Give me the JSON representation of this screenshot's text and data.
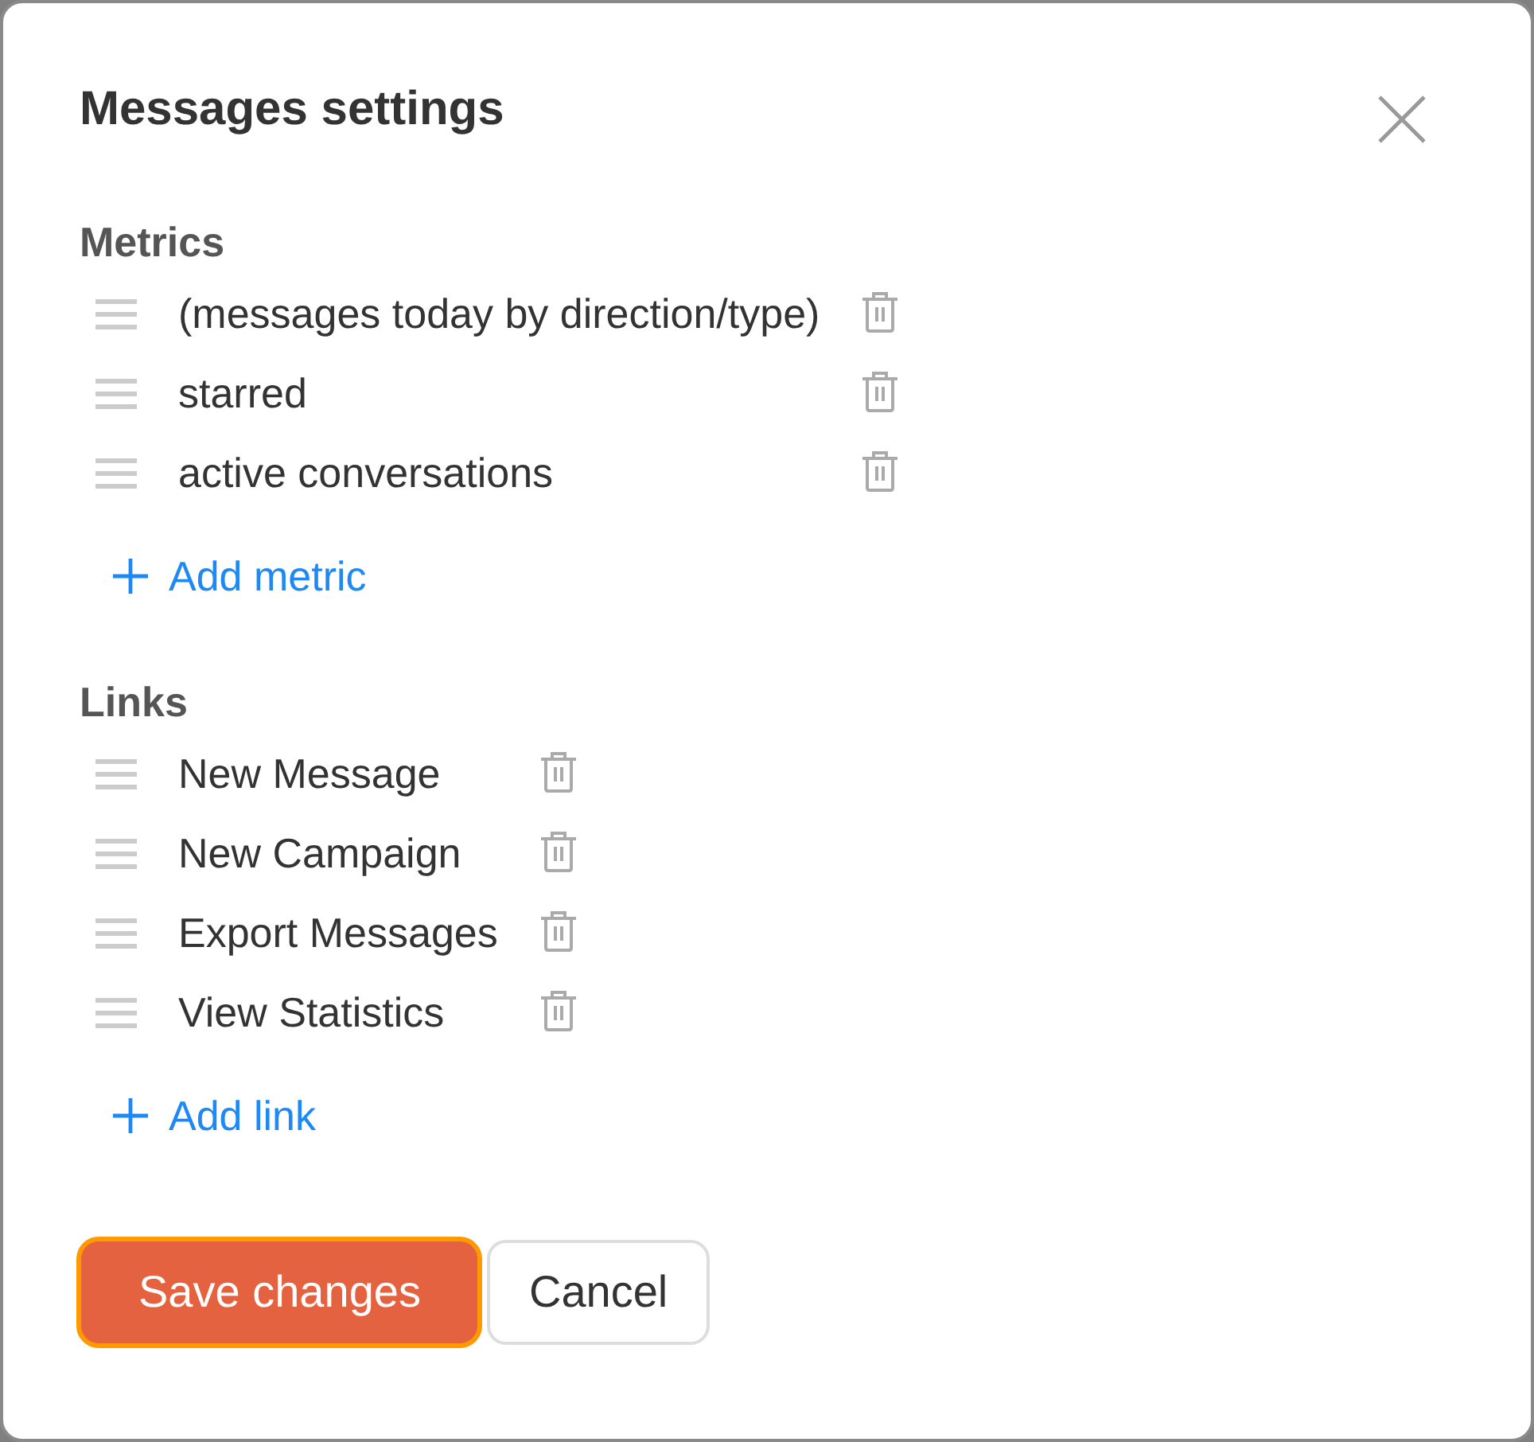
{
  "dialog": {
    "title": "Messages settings"
  },
  "sections": [
    {
      "heading": "Metrics",
      "items": [
        {
          "label": "(messages today by direction/type)"
        },
        {
          "label": "starred"
        },
        {
          "label": "active conversations"
        }
      ],
      "add_action": "Add metric"
    },
    {
      "heading": "Links",
      "items": [
        {
          "label": "New Message"
        },
        {
          "label": "New Campaign"
        },
        {
          "label": "Export Messages"
        },
        {
          "label": "View Statistics"
        }
      ],
      "add_action": "Add link"
    }
  ],
  "buttons": [
    {
      "label": "Save changes",
      "kind": "primary",
      "focused": true
    },
    {
      "label": "Cancel",
      "kind": "secondary",
      "focused": false
    }
  ]
}
